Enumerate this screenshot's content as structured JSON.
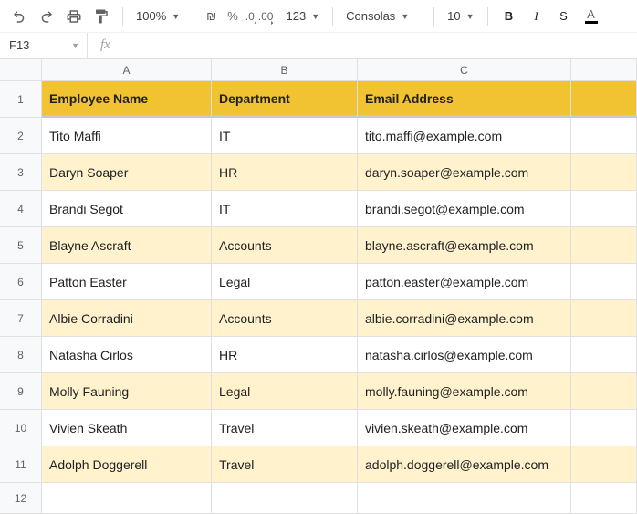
{
  "toolbar": {
    "zoom": "100%",
    "currency_symbol": "₪",
    "percent": "%",
    "dec_dec": ".0",
    "inc_dec": ".00",
    "more_formats": "123",
    "font": "Consolas",
    "font_size": "10",
    "bold": "B",
    "italic": "I",
    "strike": "S",
    "textcolor": "A"
  },
  "namebox": "F13",
  "fx_label": "fx",
  "columns": [
    "A",
    "B",
    "C",
    ""
  ],
  "headers": {
    "name": "Employee Name",
    "dept": "Department",
    "email": "Email Address"
  },
  "rows": [
    {
      "n": "1"
    },
    {
      "n": "2",
      "name": "Tito Maffi",
      "dept": "IT",
      "email": "tito.maffi@example.com"
    },
    {
      "n": "3",
      "name": "Daryn Soaper",
      "dept": "HR",
      "email": "daryn.soaper@example.com"
    },
    {
      "n": "4",
      "name": "Brandi Segot",
      "dept": "IT",
      "email": "brandi.segot@example.com"
    },
    {
      "n": "5",
      "name": "Blayne Ascraft",
      "dept": "Accounts",
      "email": "blayne.ascraft@example.com"
    },
    {
      "n": "6",
      "name": "Patton Easter",
      "dept": "Legal",
      "email": "patton.easter@example.com"
    },
    {
      "n": "7",
      "name": "Albie Corradini",
      "dept": "Accounts",
      "email": "albie.corradini@example.com"
    },
    {
      "n": "8",
      "name": "Natasha Cirlos",
      "dept": "HR",
      "email": "natasha.cirlos@example.com"
    },
    {
      "n": "9",
      "name": "Molly Fauning",
      "dept": "Legal",
      "email": "molly.fauning@example.com"
    },
    {
      "n": "10",
      "name": "Vivien Skeath",
      "dept": "Travel",
      "email": "vivien.skeath@example.com"
    },
    {
      "n": "11",
      "name": "Adolph Doggerell",
      "dept": "Travel",
      "email": "adolph.doggerell@example.com"
    },
    {
      "n": "12"
    }
  ]
}
